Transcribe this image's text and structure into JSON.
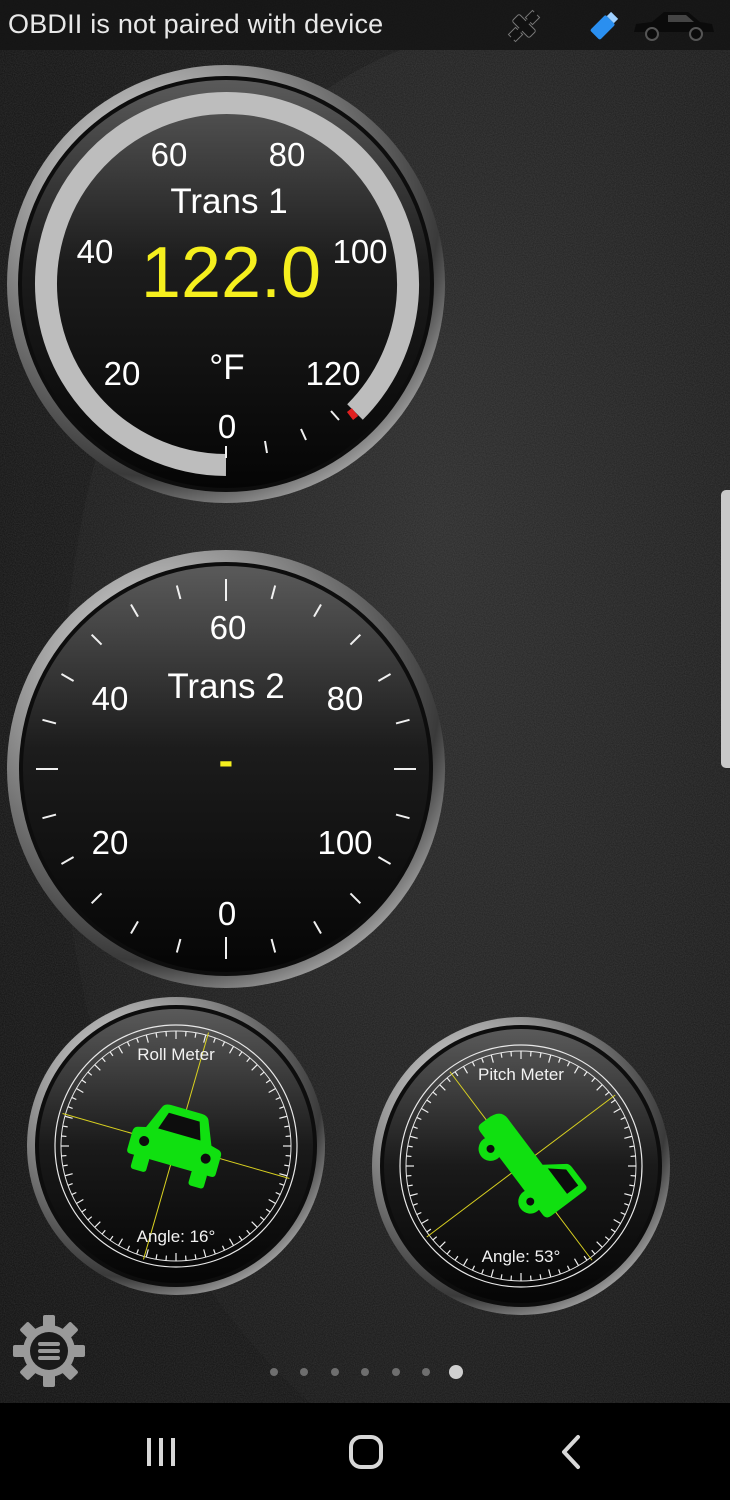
{
  "status_bar": {
    "message": "OBDII is not paired with device",
    "icons": [
      "gps-off-icon",
      "bluetooth-adapter-icon",
      "car-icon"
    ]
  },
  "gauges": {
    "trans1": {
      "title": "Trans 1",
      "value": "122.0",
      "unit": "°F",
      "ticks": [
        "0",
        "20",
        "40",
        "60",
        "80",
        "100",
        "120"
      ],
      "progress_value": 122.0,
      "range": [
        0,
        125
      ],
      "value_color": "#f5ef1e"
    },
    "trans2": {
      "title": "Trans 2",
      "value": "-",
      "ticks": [
        "0",
        "20",
        "40",
        "60",
        "80",
        "100"
      ],
      "value_color": "#f5ef1e"
    },
    "roll": {
      "title": "Roll Meter",
      "angle_label": "Angle: 16°",
      "angle_deg": 16,
      "car_color": "#10e010"
    },
    "pitch": {
      "title": "Pitch Meter",
      "angle_label": "Angle: 53°",
      "angle_deg": 53,
      "car_color": "#10e010"
    }
  },
  "pager": {
    "count": 7,
    "active_index": 6
  },
  "nav_bar": {
    "buttons": [
      "recent-apps-icon",
      "home-icon",
      "back-icon"
    ]
  },
  "colors": {
    "accent_yellow": "#f5ef1e",
    "alert_red": "#e02020",
    "status_bar_bg": "#141414"
  }
}
